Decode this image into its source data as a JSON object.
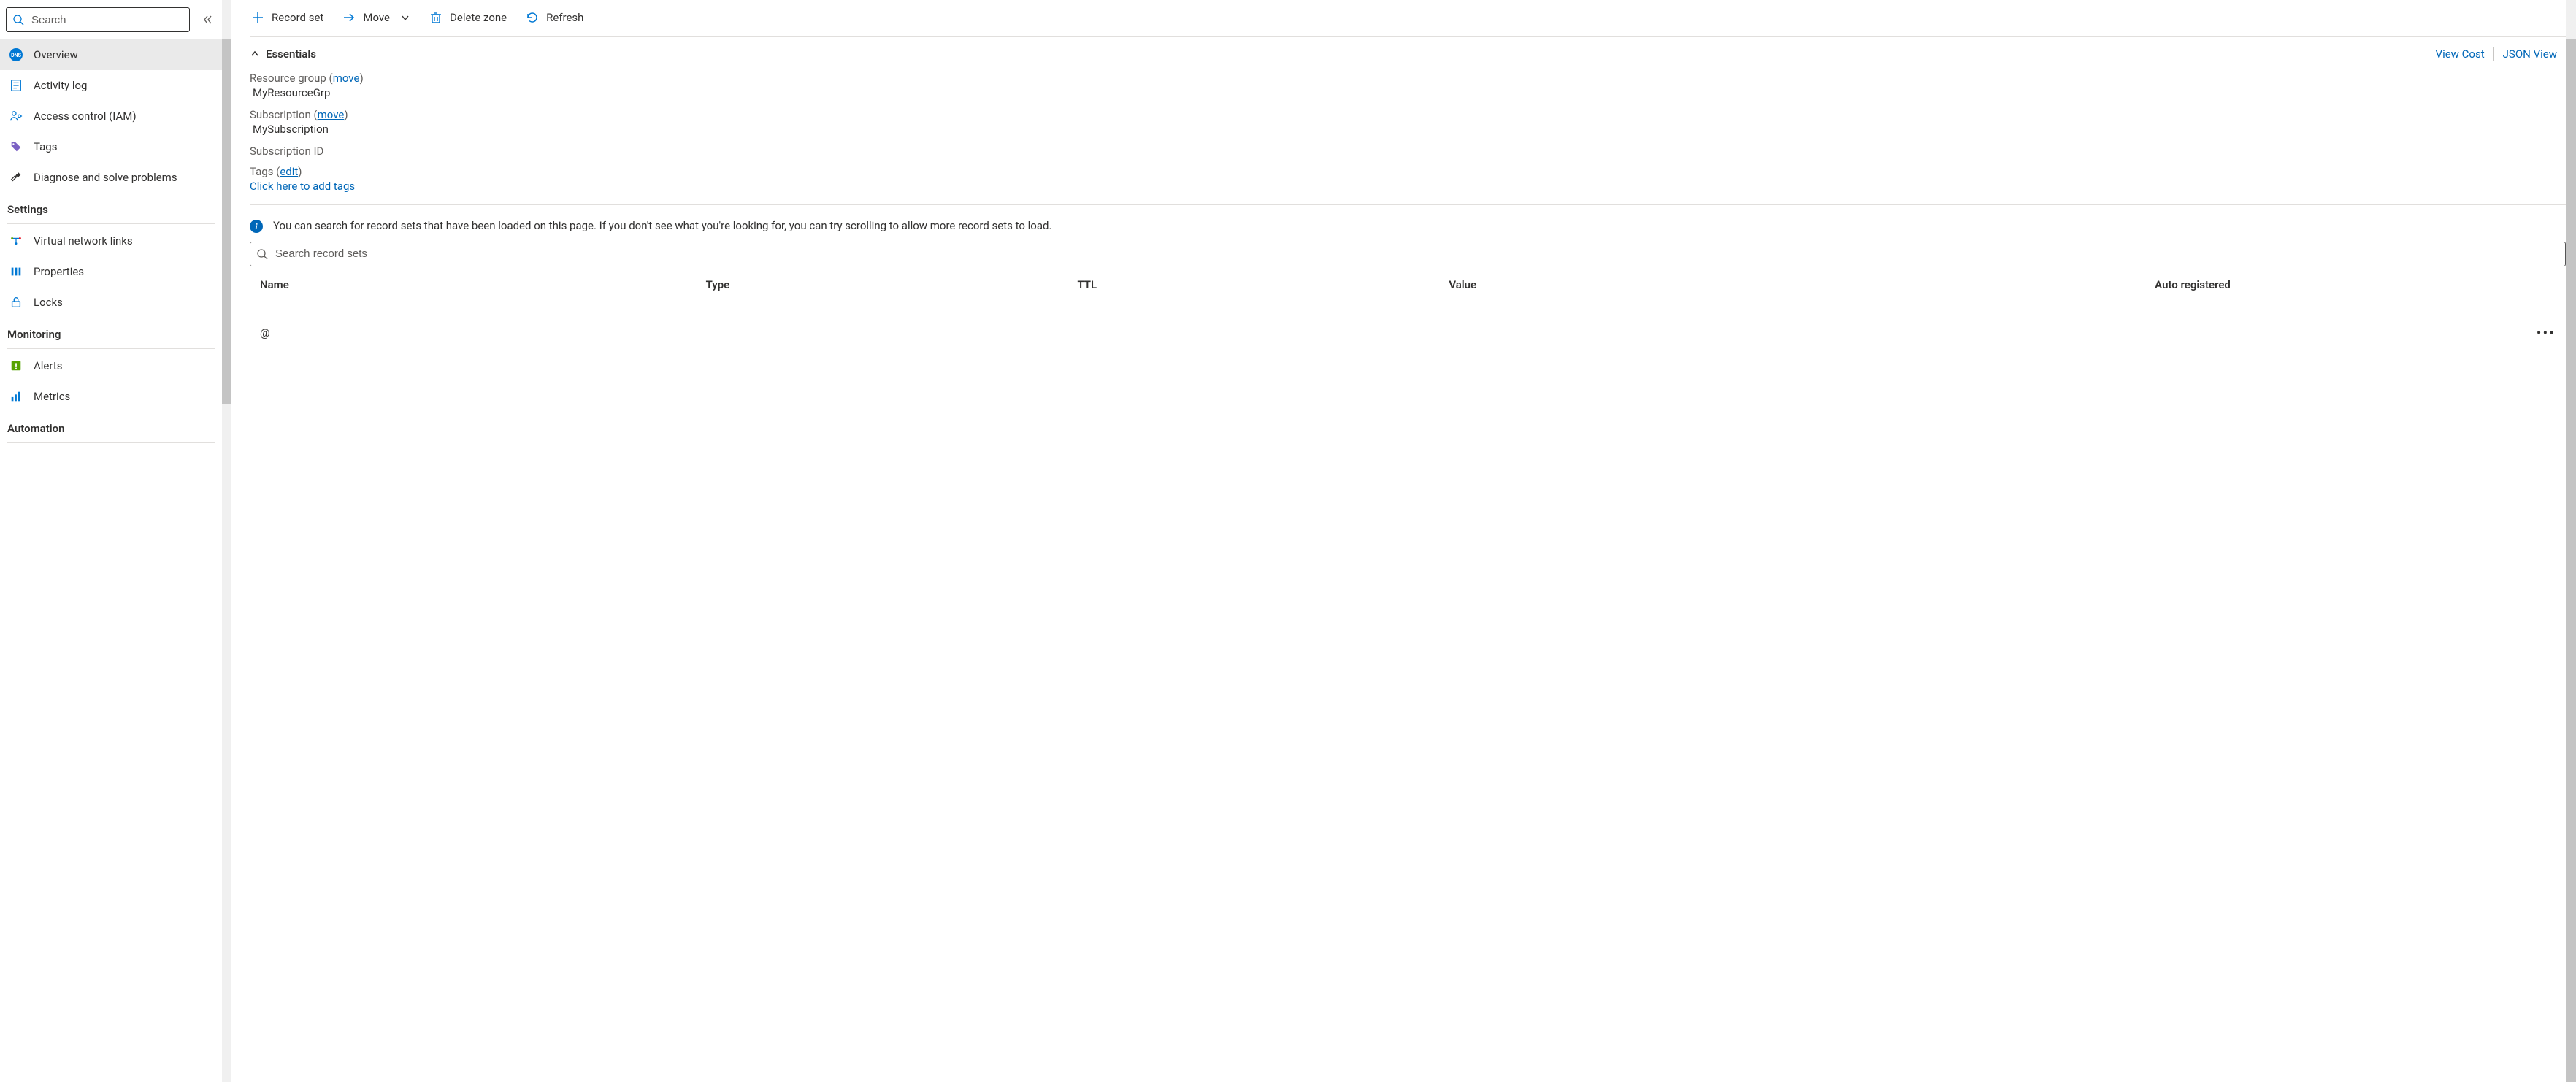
{
  "sidebar": {
    "search_placeholder": "Search",
    "items": [
      {
        "label": "Overview",
        "selected": true
      },
      {
        "label": "Activity log"
      },
      {
        "label": "Access control (IAM)"
      },
      {
        "label": "Tags"
      },
      {
        "label": "Diagnose and solve problems"
      }
    ],
    "sections": [
      {
        "title": "Settings",
        "items": [
          {
            "label": "Virtual network links"
          },
          {
            "label": "Properties"
          },
          {
            "label": "Locks"
          }
        ]
      },
      {
        "title": "Monitoring",
        "items": [
          {
            "label": "Alerts"
          },
          {
            "label": "Metrics"
          }
        ]
      },
      {
        "title": "Automation",
        "items": []
      }
    ]
  },
  "toolbar": {
    "record_set": "Record set",
    "move": "Move",
    "delete_zone": "Delete zone",
    "refresh": "Refresh"
  },
  "essentials": {
    "title": "Essentials",
    "view_cost": "View Cost",
    "json_view": "JSON View",
    "rg_label_prefix": "Resource group (",
    "rg_move": "move",
    "rg_label_suffix": ")",
    "rg_value": "MyResourceGrp",
    "sub_label_prefix": "Subscription (",
    "sub_move": "move",
    "sub_label_suffix": ")",
    "sub_value": "MySubscription",
    "sub_id_label": "Subscription ID",
    "tags_label_prefix": "Tags (",
    "tags_edit": "edit",
    "tags_label_suffix": ")",
    "tags_add_link": "Click here to add tags"
  },
  "info": {
    "text": "You can search for record sets that have been loaded on this page. If you don't see what you're looking for, you can try scrolling to allow more record sets to load."
  },
  "records": {
    "search_placeholder": "Search record sets",
    "columns": {
      "name": "Name",
      "type": "Type",
      "ttl": "TTL",
      "value": "Value",
      "auto": "Auto registered"
    },
    "rows": [
      {
        "name": "@",
        "type": "",
        "ttl": "",
        "value": "",
        "auto": ""
      }
    ]
  }
}
